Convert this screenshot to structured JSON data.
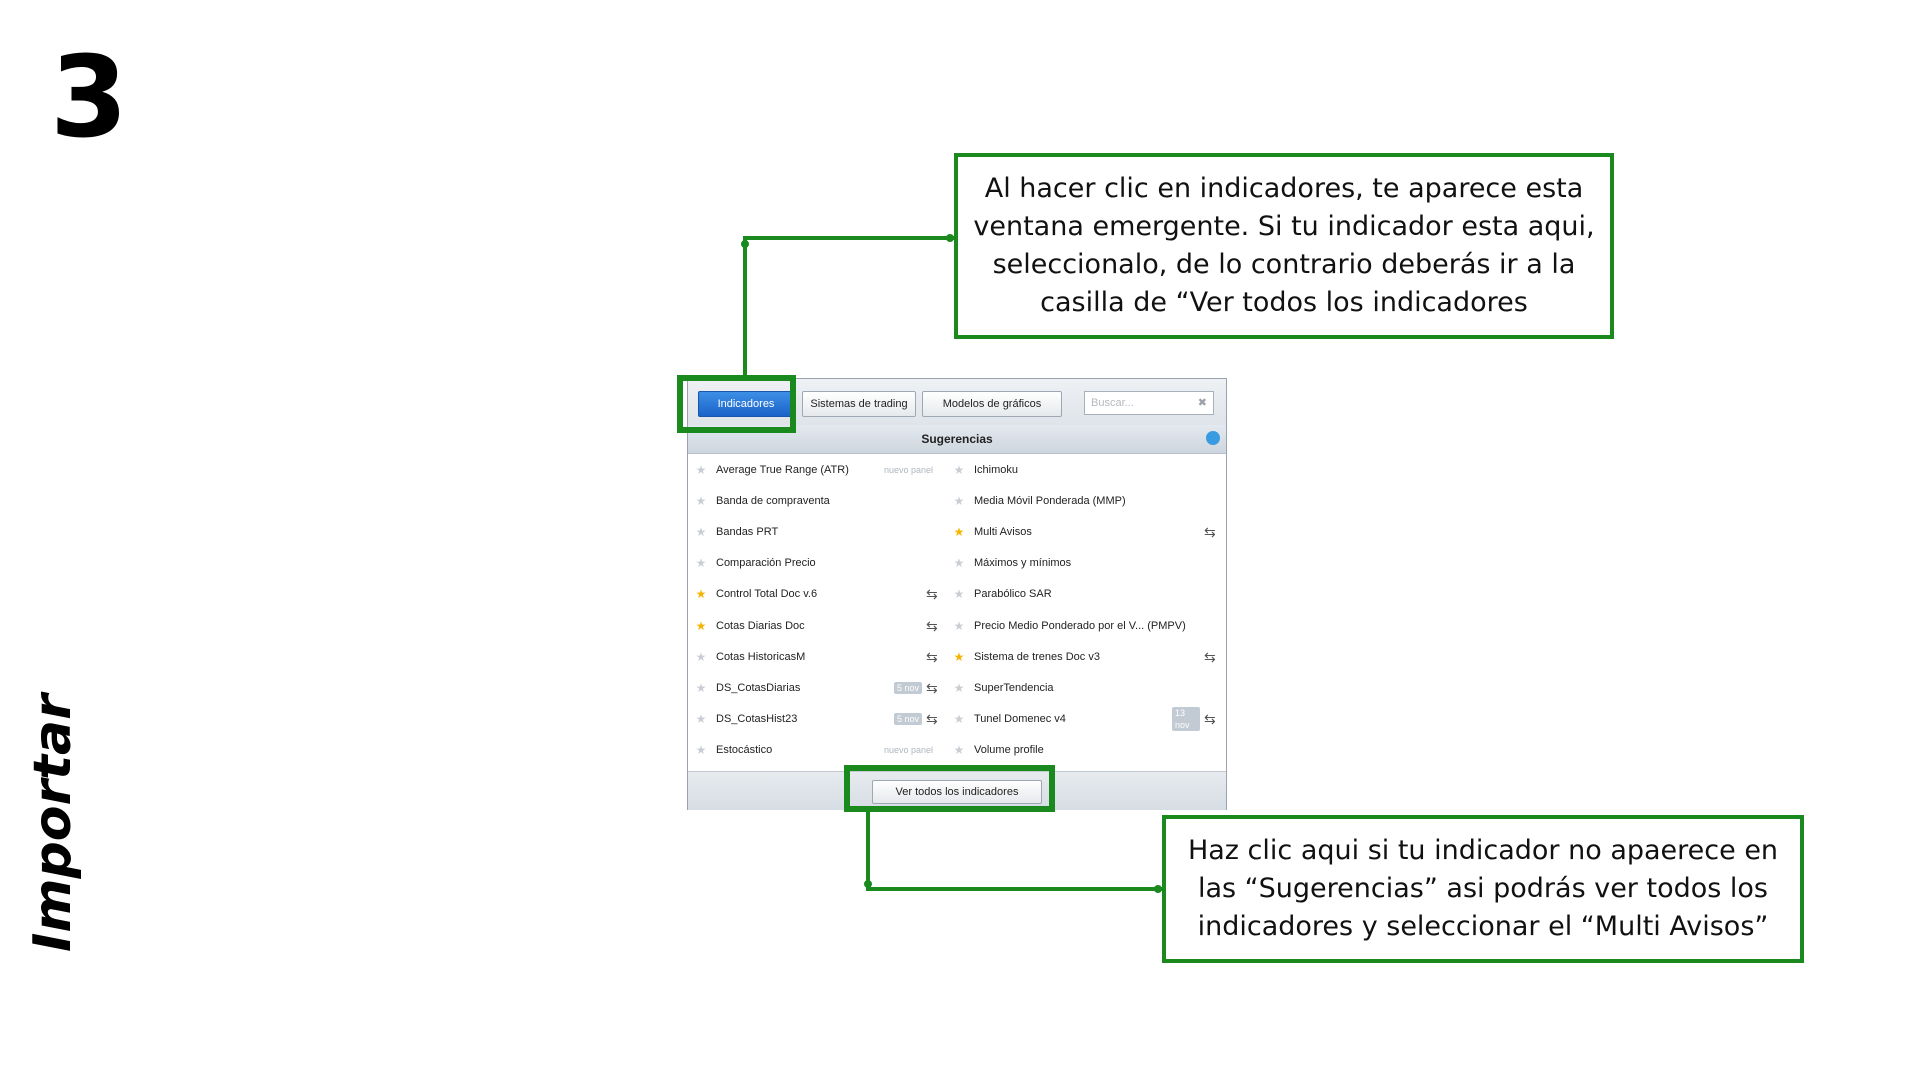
{
  "step_number": "3",
  "vertical_title": "Importar",
  "callouts": {
    "top": "Al hacer clic en indicadores, te aparece esta ventana emergente. Si tu indicador esta aqui, seleccionalo, de lo contrario deberás ir a la casilla de “Ver todos los indicadores",
    "bottom": "Haz clic aqui si tu indicador no apaerece en las “Sugerencias” asi podrás ver todos los indicadores y seleccionar el “Multi Avisos”"
  },
  "colors": {
    "accent_green": "#1a8a1f",
    "tab_active_blue": "#1a63c9",
    "favorite_star": "#f4b400"
  },
  "panel": {
    "tabs": [
      {
        "label": "Indicadores",
        "active": true
      },
      {
        "label": "Sistemas de trading",
        "active": false
      },
      {
        "label": "Modelos de gráficos",
        "active": false
      }
    ],
    "search": {
      "placeholder": "Buscar...",
      "clear_icon": "✖"
    },
    "suggestions_header": "Sugerencias",
    "left_items": [
      {
        "label": "Average True Range (ATR)",
        "favorite": false,
        "note": "nuevo panel"
      },
      {
        "label": "Banda de compraventa",
        "favorite": false
      },
      {
        "label": "Bandas PRT",
        "favorite": false
      },
      {
        "label": "Comparación Precio",
        "favorite": false
      },
      {
        "label": "Control Total Doc v.6",
        "favorite": true,
        "sync": true
      },
      {
        "label": "Cotas Diarias Doc",
        "favorite": true,
        "sync": true
      },
      {
        "label": "Cotas HistoricasM",
        "favorite": false,
        "sync": true
      },
      {
        "label": "DS_CotasDiarias",
        "favorite": false,
        "badge": "5 nov",
        "sync": true
      },
      {
        "label": "DS_CotasHist23",
        "favorite": false,
        "badge": "5 nov",
        "sync": true
      },
      {
        "label": "Estocástico",
        "favorite": false,
        "note": "nuevo panel"
      }
    ],
    "right_items": [
      {
        "label": "Ichimoku",
        "favorite": false
      },
      {
        "label": "Media Móvil Ponderada (MMP)",
        "favorite": false
      },
      {
        "label": "Multi Avisos",
        "favorite": true,
        "sync": true
      },
      {
        "label": "Máximos y mínimos",
        "favorite": false
      },
      {
        "label": "Parabólico SAR",
        "favorite": false
      },
      {
        "label": "Precio Medio Ponderado por el V... (PMPV)",
        "favorite": false
      },
      {
        "label": "Sistema de trenes Doc v3",
        "favorite": true,
        "sync": true
      },
      {
        "label": "SuperTendencia",
        "favorite": false
      },
      {
        "label": "Tunel Domenec v4",
        "favorite": false,
        "badge": "13 nov",
        "sync": true
      },
      {
        "label": "Volume profile",
        "favorite": false
      }
    ],
    "view_all_button": "Ver todos los indicadores"
  }
}
